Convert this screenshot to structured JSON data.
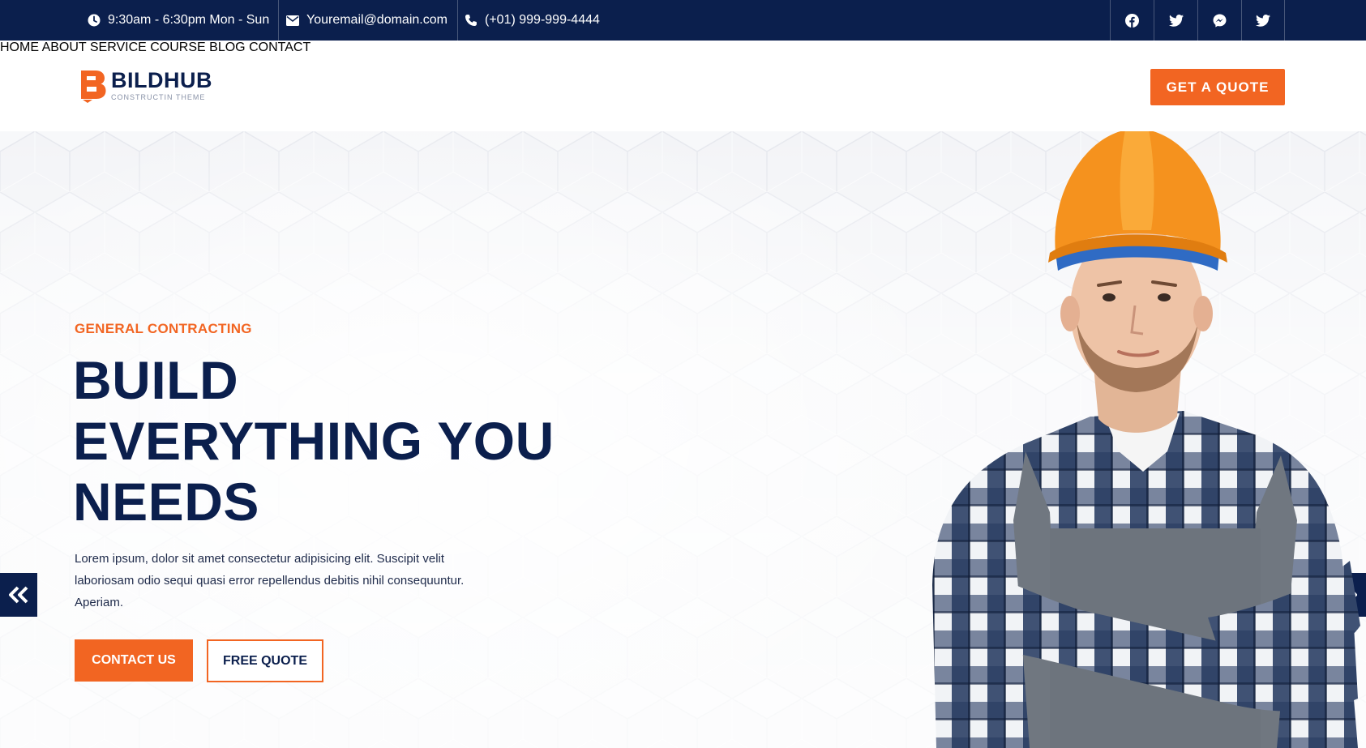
{
  "topbar": {
    "hours": "9:30am - 6:30pm Mon - Sun",
    "email": "Youremail@domain.com",
    "phone": "(+01) 999-999-4444",
    "social_icons": [
      "facebook-icon",
      "twitter-icon",
      "messenger-icon",
      "twitter-icon"
    ]
  },
  "brand": {
    "name": "BILDHUB",
    "tagline": "CONSTRUCTIN THEME",
    "logo_icon": "b-logo-icon"
  },
  "nav": {
    "items": [
      "HOME",
      "ABOUT",
      "SERVICE",
      "COURSE",
      "BLOG",
      "CONTACT"
    ],
    "cta": "GET A QUOTE"
  },
  "hero": {
    "eyebrow": "GENERAL CONTRACTING",
    "headline": [
      "BUILD",
      "EVERYTHING YOU",
      "NEEDS"
    ],
    "description": "Lorem ipsum, dolor sit amet consectetur adipisicing elit. Suscipit velit laboriosam odio sequi quasi error repellendus debitis nihil consequuntur. Aperiam.",
    "primary_button": "CONTACT US",
    "secondary_button": "FREE QUOTE",
    "prev_icon": "double-chevron-left-icon",
    "next_icon": "double-chevron-right-icon"
  },
  "colors": {
    "navy": "#0b1f4d",
    "accent": "#f26522",
    "white": "#ffffff"
  }
}
